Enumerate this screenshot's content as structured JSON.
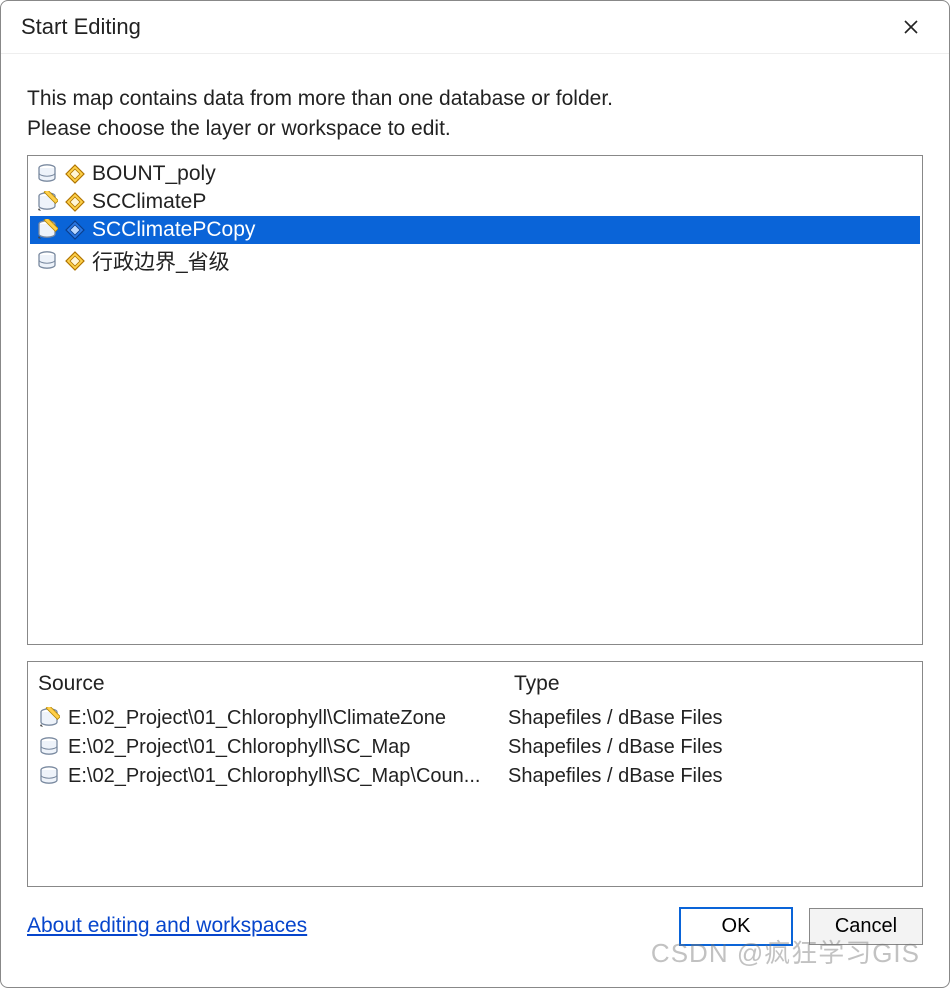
{
  "title": "Start Editing",
  "instructions_line1": "This map contains data from more than one database or folder.",
  "instructions_line2": "Please choose the layer or workspace to edit.",
  "layers": [
    {
      "label": "BOUNT_poly",
      "db_icon": "db-plain",
      "shape_icon": "poly-orange",
      "selected": false
    },
    {
      "label": "SCClimateP",
      "db_icon": "db-edit",
      "shape_icon": "poly-orange",
      "selected": false
    },
    {
      "label": "SCClimatePCopy",
      "db_icon": "db-edit",
      "shape_icon": "poly-blue",
      "selected": true
    },
    {
      "label": "行政边界_省级",
      "db_icon": "db-plain",
      "shape_icon": "poly-orange",
      "selected": false
    }
  ],
  "source_panel": {
    "header_source": "Source",
    "header_type": "Type",
    "rows": [
      {
        "icon": "db-edit",
        "path": "E:\\02_Project\\01_Chlorophyll\\ClimateZone",
        "type": "Shapefiles / dBase Files"
      },
      {
        "icon": "db-plain",
        "path": "E:\\02_Project\\01_Chlorophyll\\SC_Map",
        "type": "Shapefiles / dBase Files"
      },
      {
        "icon": "db-plain",
        "path": "E:\\02_Project\\01_Chlorophyll\\SC_Map\\Coun...",
        "type": "Shapefiles / dBase Files"
      }
    ]
  },
  "about_link": "About editing and workspaces",
  "ok_label": "OK",
  "cancel_label": "Cancel",
  "watermark": "CSDN @疯狂学习GIS"
}
